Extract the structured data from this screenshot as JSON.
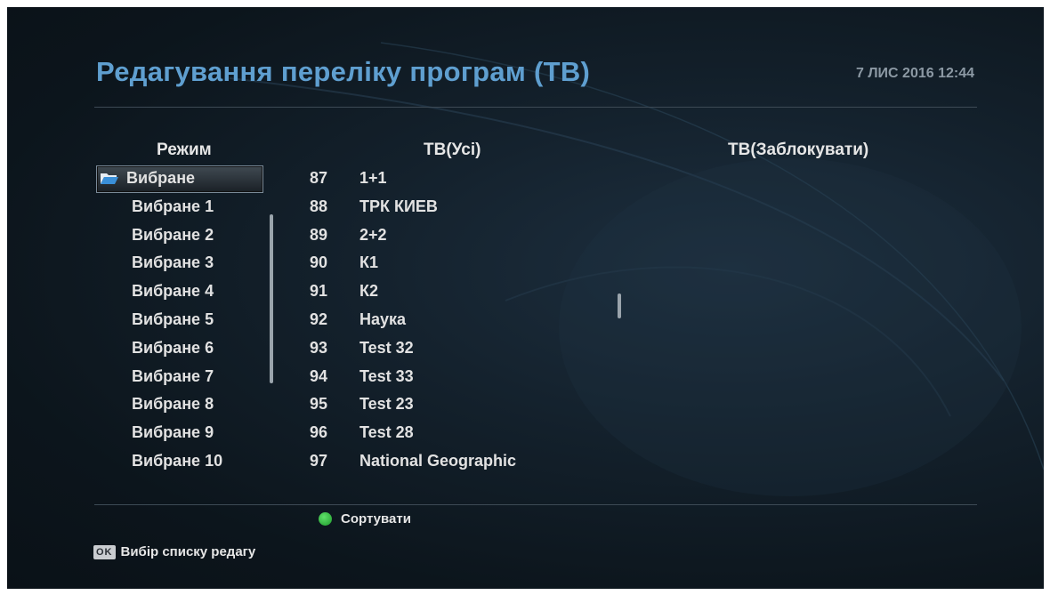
{
  "header": {
    "title": "Редагування переліку програм (ТВ)",
    "datetime": "7 ЛИС 2016 12:44"
  },
  "columns": {
    "mode": "Режим",
    "all": "ТВ(Усі)",
    "blocked": "ТВ(Заблокувати)"
  },
  "mode_list": {
    "selected": "Вибране",
    "items": [
      "Вибране 1",
      "Вибране 2",
      "Вибране 3",
      "Вибране 4",
      "Вибране 5",
      "Вибране 6",
      "Вибране 7",
      "Вибране 8",
      "Вибране 9",
      "Вибране 10"
    ]
  },
  "channels": [
    {
      "num": "87",
      "name": "1+1"
    },
    {
      "num": "88",
      "name": "ТРК КИЕВ"
    },
    {
      "num": "89",
      "name": "2+2"
    },
    {
      "num": "90",
      "name": "К1"
    },
    {
      "num": "91",
      "name": "К2"
    },
    {
      "num": "92",
      "name": "Наука"
    },
    {
      "num": "93",
      "name": "Test 32"
    },
    {
      "num": "94",
      "name": "Test 33"
    },
    {
      "num": "95",
      "name": "Test 23"
    },
    {
      "num": "96",
      "name": "Test 28"
    },
    {
      "num": "97",
      "name": "National Geographic"
    }
  ],
  "footer": {
    "sort_label": "Сортувати",
    "ok_key": "OK",
    "ok_label": "Вибір списку редагу"
  },
  "colors": {
    "title": "#5f9fd0",
    "sort_button": "#2fbf3a"
  },
  "icons": {
    "selected_folder": "folder-open-icon",
    "sort": "green-button-icon"
  }
}
